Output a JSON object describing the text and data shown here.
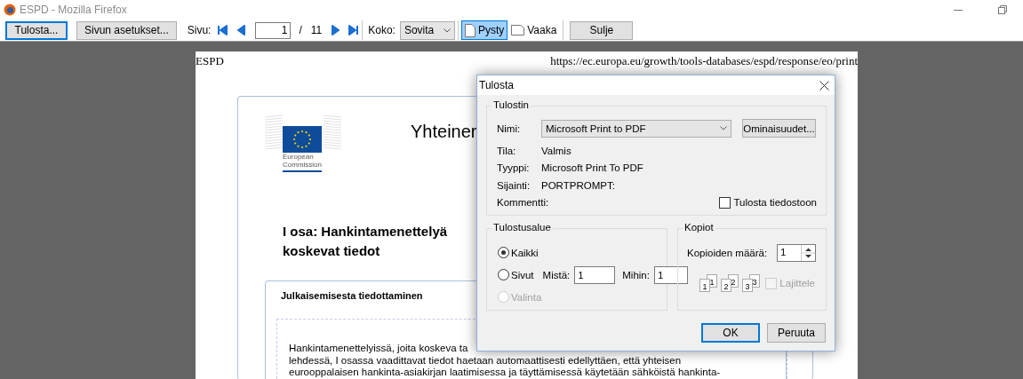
{
  "window": {
    "title": "ESPD - Mozilla Firefox"
  },
  "toolbar": {
    "print_button": "Tulosta...",
    "page_setup_button": "Sivun asetukset...",
    "page_label": "Sivu:",
    "page_field": "1",
    "page_separator": "/",
    "page_count": "11",
    "scale_label": "Koko:",
    "scale_select": "Sovita",
    "orientations": [
      {
        "label": "Pysty",
        "selected": true
      },
      {
        "label": "Vaaka",
        "selected": false
      }
    ],
    "close_button": "Sulje"
  },
  "page": {
    "header_left": "ESPD",
    "header_right": "https://ec.europa.eu/growth/tools-databases/espd/response/eo/print",
    "logo_text": "European Commission",
    "title": "Yhteiner",
    "heading_lines": [
      "I osa: Hankintamenettelyä",
      "koskevat tiedot"
    ],
    "section_title": "Julkaisemisesta tiedottaminen",
    "paragraph_lines": [
      "Hankintamenettelyissä, joita koskeva ta",
      "lehdessä, I osassa vaadittavat tiedot haetaan automaattisesti edellyttäen, että yhteisen",
      "eurooppalaisen hankinta-asiakirjan laatimisessa ja täyttämisessä käytetään sähköistä hankinta-"
    ]
  },
  "dialog": {
    "title": "Tulosta",
    "printer": {
      "legend": "Tulostin",
      "name_label": "Nimi:",
      "name_select": "Microsoft Print to PDF",
      "properties_button": "Ominaisuudet...",
      "info": [
        {
          "label": "Tila:",
          "value": "Valmis"
        },
        {
          "label": "Tyyppi:",
          "value": "Microsoft Print To PDF"
        },
        {
          "label": "Sijainti:",
          "value": "PORTPROMPT:"
        },
        {
          "label": "Kommentti:"
        }
      ],
      "print_to_file": {
        "label": "Tulosta tiedostoon",
        "checked": false
      }
    },
    "range": {
      "legend": "Tulostusalue",
      "options": [
        {
          "label": "Kaikki",
          "selected": true,
          "disabled": false
        },
        {
          "label": "Sivut",
          "selected": false,
          "disabled": false
        },
        {
          "label": "Valinta",
          "selected": false,
          "disabled": true
        }
      ],
      "from_label": "Mistä:",
      "from_value": "1",
      "to_label": "Mihin:",
      "to_value": "1"
    },
    "copies": {
      "legend": "Kopiot",
      "count_label": "Kopioiden määrä:",
      "count_value": "1",
      "collate_sets": [
        {
          "front": "1",
          "back": "1"
        },
        {
          "front": "2",
          "back": "2"
        },
        {
          "front": "3",
          "back": "3"
        }
      ],
      "collate": {
        "label": "Lajittele",
        "checked": false,
        "disabled": true
      }
    },
    "buttons": [
      {
        "label": "OK",
        "default": true
      },
      {
        "label": "Peruuta",
        "default": false
      }
    ]
  }
}
